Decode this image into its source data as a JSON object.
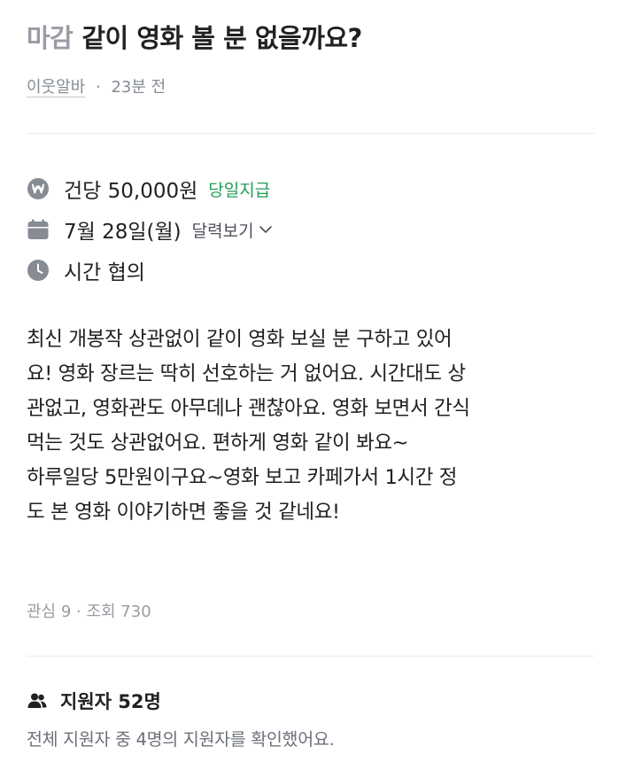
{
  "post": {
    "status": "마감",
    "title": "같이 영화 볼 분 없을까요?",
    "author": "이웃알바",
    "separator": "·",
    "time_ago": "23분 전"
  },
  "info": {
    "wage": "건당 50,000원",
    "pay_tag": "당일지급",
    "date": "7월 28일(월)",
    "calendar_link": "달력보기",
    "time": "시간 협의",
    "icons": {
      "wage": "won-coin-icon",
      "date": "calendar-icon",
      "time": "clock-icon"
    }
  },
  "body": "최신 개봉작 상관없이 같이 영화 보실 분 구하고 있어\n요! 영화 장르는 딱히 선호하는 거 없어요. 시간대도 상\n관없고, 영화관도 아무데나 괜찮아요. 영화 보면서 간식\n먹는 것도 상관없어요. 편하게 영화 같이 봐요~\n하루일당 5만원이구요~영화 보고 카페가서 1시간 정\n도 본 영화 이야기하면 좋을 것 같네요!",
  "stats": {
    "text": "관심 9 · 조회 730"
  },
  "applicants": {
    "title": "지원자 52명",
    "description": "전체 지원자 중 4명의 지원자를 확인했어요.",
    "icon": "people-icon"
  },
  "colors": {
    "text": "#212124",
    "muted": "#868b94",
    "status": "#9a9ca3",
    "pay_tag": "#1f9c55",
    "icon": "#868b94",
    "divider": "#eaebee"
  }
}
